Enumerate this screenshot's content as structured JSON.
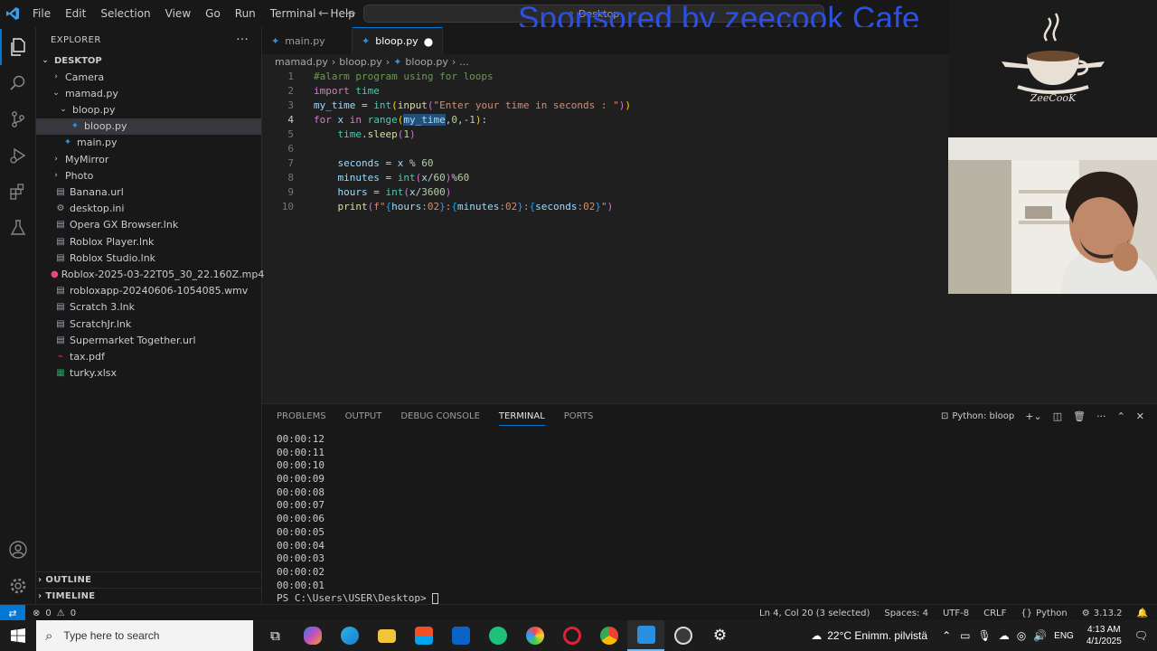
{
  "menu": [
    "File",
    "Edit",
    "Selection",
    "View",
    "Go",
    "Run",
    "Terminal",
    "Help"
  ],
  "command_center": "Desktop",
  "sponsor_text": "Sponsored by zeecook Cafe",
  "logo_text": "ZeeCooK",
  "explorer": {
    "title": "EXPLORER",
    "root": "DESKTOP",
    "items": [
      {
        "label": "Camera",
        "indent": 1,
        "folder": true,
        "open": false
      },
      {
        "label": "mamad.py",
        "indent": 1,
        "folder": true,
        "open": true
      },
      {
        "label": "bloop.py",
        "indent": 2,
        "folder": true,
        "open": true
      },
      {
        "label": "bloop.py",
        "indent": 3,
        "folder": false,
        "icon": "python",
        "selected": true
      },
      {
        "label": "main.py",
        "indent": 2,
        "folder": false,
        "icon": "python"
      },
      {
        "label": "MyMirror",
        "indent": 1,
        "folder": true,
        "open": false
      },
      {
        "label": "Photo",
        "indent": 1,
        "folder": true,
        "open": false
      },
      {
        "label": "Banana.url",
        "indent": 1,
        "folder": false,
        "icon": "file"
      },
      {
        "label": "desktop.ini",
        "indent": 1,
        "folder": false,
        "icon": "gear"
      },
      {
        "label": "Opera GX Browser.lnk",
        "indent": 1,
        "folder": false,
        "icon": "file"
      },
      {
        "label": "Roblox Player.lnk",
        "indent": 1,
        "folder": false,
        "icon": "file"
      },
      {
        "label": "Roblox Studio.lnk",
        "indent": 1,
        "folder": false,
        "icon": "file"
      },
      {
        "label": "Roblox-2025-03-22T05_30_22.160Z.mp4",
        "indent": 1,
        "folder": false,
        "icon": "video"
      },
      {
        "label": "robloxapp-20240606-1054085.wmv",
        "indent": 1,
        "folder": false,
        "icon": "file"
      },
      {
        "label": "Scratch 3.lnk",
        "indent": 1,
        "folder": false,
        "icon": "file"
      },
      {
        "label": "ScratchJr.lnk",
        "indent": 1,
        "folder": false,
        "icon": "file"
      },
      {
        "label": "Supermarket Together.url",
        "indent": 1,
        "folder": false,
        "icon": "file"
      },
      {
        "label": "tax.pdf",
        "indent": 1,
        "folder": false,
        "icon": "pdf"
      },
      {
        "label": "turky.xlsx",
        "indent": 1,
        "folder": false,
        "icon": "excel"
      }
    ],
    "outline": "OUTLINE",
    "timeline": "TIMELINE"
  },
  "tabs": [
    {
      "label": "main.py",
      "active": false
    },
    {
      "label": "bloop.py",
      "active": true,
      "modified": true
    }
  ],
  "breadcrumb": [
    "mamad.py",
    "bloop.py",
    "bloop.py",
    "..."
  ],
  "editor": {
    "current_line": 4,
    "line_numbers": [
      "1",
      "2",
      "3",
      "4",
      "5",
      "6",
      "7",
      "8",
      "9",
      "10"
    ]
  },
  "panel": {
    "tabs": [
      "PROBLEMS",
      "OUTPUT",
      "DEBUG CONSOLE",
      "TERMINAL",
      "PORTS"
    ],
    "active_tab": "TERMINAL",
    "terminal_name": "Python: bloop",
    "output": [
      "00:00:12",
      "00:00:11",
      "00:00:10",
      "00:00:09",
      "00:00:08",
      "00:00:07",
      "00:00:06",
      "00:00:05",
      "00:00:04",
      "00:00:03",
      "00:00:02",
      "00:00:01"
    ],
    "prompt": "PS C:\\Users\\USER\\Desktop> "
  },
  "status": {
    "errors": "0",
    "warnings": "0",
    "cursor": "Ln 4, Col 20 (3 selected)",
    "spaces": "Spaces: 4",
    "encoding": "UTF-8",
    "eol": "CRLF",
    "language": "Python",
    "version": "3.13.2"
  },
  "taskbar": {
    "search_placeholder": "Type here to search",
    "weather": "22°C  Enimm. pilvistä",
    "lang": "ENG",
    "time": "4:13 AM",
    "date": "4/1/2025"
  }
}
